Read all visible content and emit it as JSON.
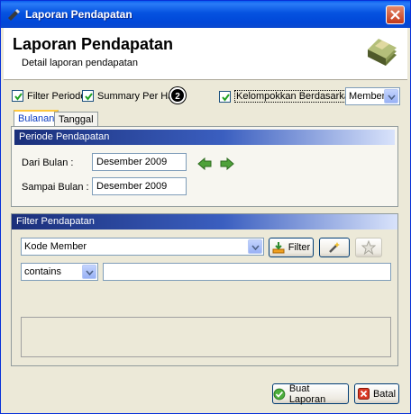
{
  "window": {
    "title": "Laporan Pendapatan"
  },
  "header": {
    "title": "Laporan Pendapatan",
    "subtitle": "Detail laporan pendapatan"
  },
  "options": {
    "filter_periode": "Filter Periode",
    "summary_per_hari": "Summary Per Hari",
    "badge": "2",
    "kelompokkan": "Kelompokkan Berdasarkan :",
    "group_by_value": "Member"
  },
  "tabs": [
    "Bulanan",
    "Tanggal"
  ],
  "periode": {
    "title": "Periode Pendapatan",
    "dari_label": "Dari Bulan :",
    "dari_value": "Desember 2009",
    "sampai_label": "Sampai Bulan :",
    "sampai_value": "Desember 2009"
  },
  "filter": {
    "title": "Filter Pendapatan",
    "field_value": "Kode Member",
    "filter_button": "Filter",
    "operator_value": "contains",
    "criteria_value": ""
  },
  "footer": {
    "buat_laporan": "Buat Laporan",
    "batal": "Batal"
  },
  "colors": {
    "titlebar": "#0a5ef0",
    "group_header": "#1a2f7a",
    "window_bg": "#ece9d8"
  },
  "icons": [
    "app-icon",
    "close-icon",
    "money-stack-icon",
    "checkmark-icon",
    "prev-arrow-icon",
    "next-arrow-icon",
    "filter-download-icon",
    "magic-wand-icon",
    "star-icon",
    "ok-check-icon",
    "cancel-x-icon"
  ]
}
